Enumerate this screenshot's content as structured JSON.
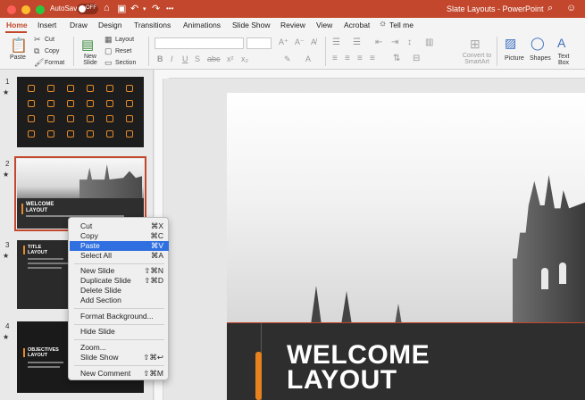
{
  "titlebar": {
    "autosave_label": "AutoSave",
    "autosave_state": "OFF",
    "app_title": "Slate Layouts - PowerPoint"
  },
  "tabs": [
    {
      "label": "Home",
      "active": true
    },
    {
      "label": "Insert"
    },
    {
      "label": "Draw"
    },
    {
      "label": "Design"
    },
    {
      "label": "Transitions"
    },
    {
      "label": "Animations"
    },
    {
      "label": "Slide Show"
    },
    {
      "label": "Review"
    },
    {
      "label": "View"
    },
    {
      "label": "Acrobat"
    },
    {
      "label": "Tell me"
    }
  ],
  "ribbon": {
    "paste": "Paste",
    "cut": "Cut",
    "copy": "Copy",
    "format": "Format",
    "new_slide": "New Slide",
    "layout": "Layout",
    "reset": "Reset",
    "section": "Section",
    "convert_smartart": "Convert to SmartArt",
    "picture": "Picture",
    "shapes": "Shapes",
    "text_box": "Text Box"
  },
  "slides": [
    {
      "number": "1"
    },
    {
      "number": "2",
      "title": "WELCOME LAYOUT"
    },
    {
      "number": "3",
      "title": "TITLE LAYOUT"
    },
    {
      "number": "4",
      "title": "OBJECTIVES LAYOUT"
    }
  ],
  "slide_title": "WELCOME LAYOUT",
  "context_menu": [
    {
      "label": "Cut",
      "shortcut": "⌘X"
    },
    {
      "label": "Copy",
      "shortcut": "⌘C"
    },
    {
      "label": "Paste",
      "shortcut": "⌘V",
      "highlighted": true
    },
    {
      "label": "Select All",
      "shortcut": "⌘A"
    },
    {
      "label": "New Slide",
      "shortcut": "⇧⌘N"
    },
    {
      "label": "Duplicate Slide",
      "shortcut": "⇧⌘D"
    },
    {
      "label": "Delete Slide",
      "shortcut": ""
    },
    {
      "label": "Add Section",
      "shortcut": ""
    },
    {
      "label": "Format Background...",
      "shortcut": ""
    },
    {
      "label": "Hide Slide",
      "shortcut": ""
    },
    {
      "label": "Zoom...",
      "shortcut": ""
    },
    {
      "label": "Slide Show",
      "shortcut": "⇧⌘↩"
    },
    {
      "label": "New Comment",
      "shortcut": "⇧⌘M"
    }
  ],
  "colors": {
    "accent": "#c3472c",
    "orange": "#e8821e",
    "highlight": "#2f6fe0"
  }
}
